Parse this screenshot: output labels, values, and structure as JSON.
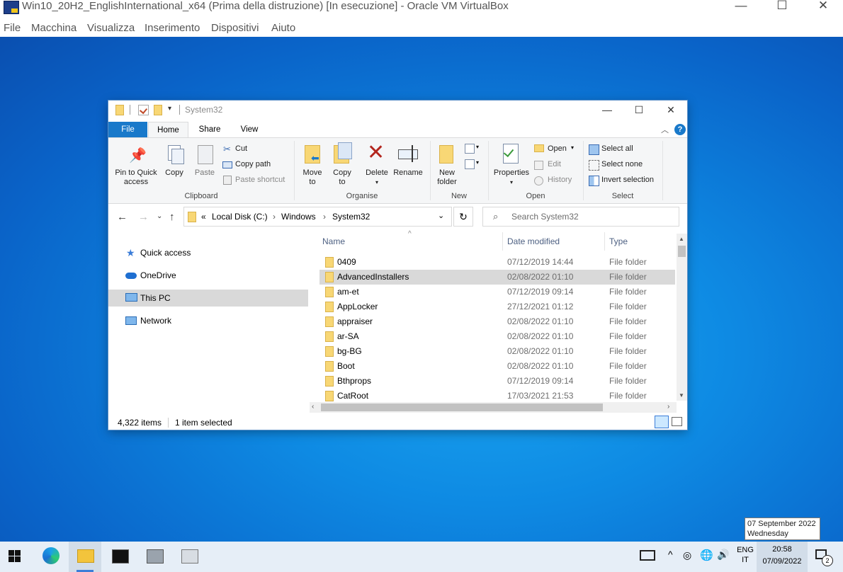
{
  "vbox": {
    "title": "Win10_20H2_EnglishInternational_x64 (Prima della distruzione) [In esecuzione] - Oracle VM VirtualBox",
    "menu": [
      "File",
      "Macchina",
      "Visualizza",
      "Inserimento",
      "Dispositivi",
      "Aiuto"
    ],
    "controls": {
      "minimize": "—",
      "maximize": "☐",
      "close": "✕"
    }
  },
  "explorer": {
    "title": "System32",
    "controls": {
      "minimize": "—",
      "maximize": "☐",
      "close": "✕"
    },
    "tabs": [
      "File",
      "Home",
      "Share",
      "View"
    ],
    "ribbon": {
      "pin_label_1": "Pin to Quick",
      "pin_label_2": "access",
      "copy_label": "Copy",
      "paste_label": "Paste",
      "cut_label": "Cut",
      "copy_path_label": "Copy path",
      "paste_shortcut_label": "Paste shortcut",
      "clipboard_group": "Clipboard",
      "move_to_1": "Move",
      "move_to_2": "to",
      "copy_to_1": "Copy",
      "copy_to_2": "to",
      "delete_label": "Delete",
      "rename_label": "Rename",
      "organise_group": "Organise",
      "new_folder_1": "New",
      "new_folder_2": "folder",
      "new_group": "New",
      "properties_label": "Properties",
      "open_label": "Open",
      "edit_label": "Edit",
      "history_label": "History",
      "open_group": "Open",
      "select_all_label": "Select all",
      "select_none_label": "Select none",
      "invert_selection_label": "Invert selection",
      "select_group": "Select"
    },
    "address": {
      "prefix": "«",
      "crumbs": [
        "Local Disk (C:)",
        "Windows",
        "System32"
      ],
      "search_placeholder": "Search System32"
    },
    "nav": {
      "items": [
        {
          "label": "Quick access",
          "icon": "star-icon"
        },
        {
          "label": "OneDrive",
          "icon": "cloud-icon"
        },
        {
          "label": "This PC",
          "icon": "computer-icon",
          "selected": true
        },
        {
          "label": "Network",
          "icon": "network-icon"
        }
      ]
    },
    "columns": {
      "name": "Name",
      "date": "Date modified",
      "type": "Type"
    },
    "files": [
      {
        "name": "0409",
        "date": "07/12/2019 14:44",
        "type": "File folder"
      },
      {
        "name": "AdvancedInstallers",
        "date": "02/08/2022 01:10",
        "type": "File folder",
        "selected": true
      },
      {
        "name": "am-et",
        "date": "07/12/2019 09:14",
        "type": "File folder"
      },
      {
        "name": "AppLocker",
        "date": "27/12/2021 01:12",
        "type": "File folder"
      },
      {
        "name": "appraiser",
        "date": "02/08/2022 01:10",
        "type": "File folder"
      },
      {
        "name": "ar-SA",
        "date": "02/08/2022 01:10",
        "type": "File folder"
      },
      {
        "name": "bg-BG",
        "date": "02/08/2022 01:10",
        "type": "File folder"
      },
      {
        "name": "Boot",
        "date": "02/08/2022 01:10",
        "type": "File folder"
      },
      {
        "name": "Bthprops",
        "date": "07/12/2019 09:14",
        "type": "File folder"
      },
      {
        "name": "CatRoot",
        "date": "17/03/2021 21:53",
        "type": "File folder"
      }
    ],
    "status": {
      "items": "4,322 items",
      "selected": "1 item selected"
    }
  },
  "taskbar": {
    "apps": [
      "windows-start-icon",
      "edge-icon",
      "file-explorer-icon",
      "command-prompt-icon",
      "app-icon",
      "app-icon-2"
    ],
    "lang_1": "ENG",
    "lang_2": "IT",
    "time": "20:58",
    "date": "07/09/2022",
    "notifications": "2",
    "tooltip_1": "07 September 2022",
    "tooltip_2": "Wednesday"
  },
  "colors": {
    "desktop": "#0e8ae3",
    "accent": "#1979ca",
    "selection": "#cce8ff",
    "taskbar": "#e6eef7"
  }
}
